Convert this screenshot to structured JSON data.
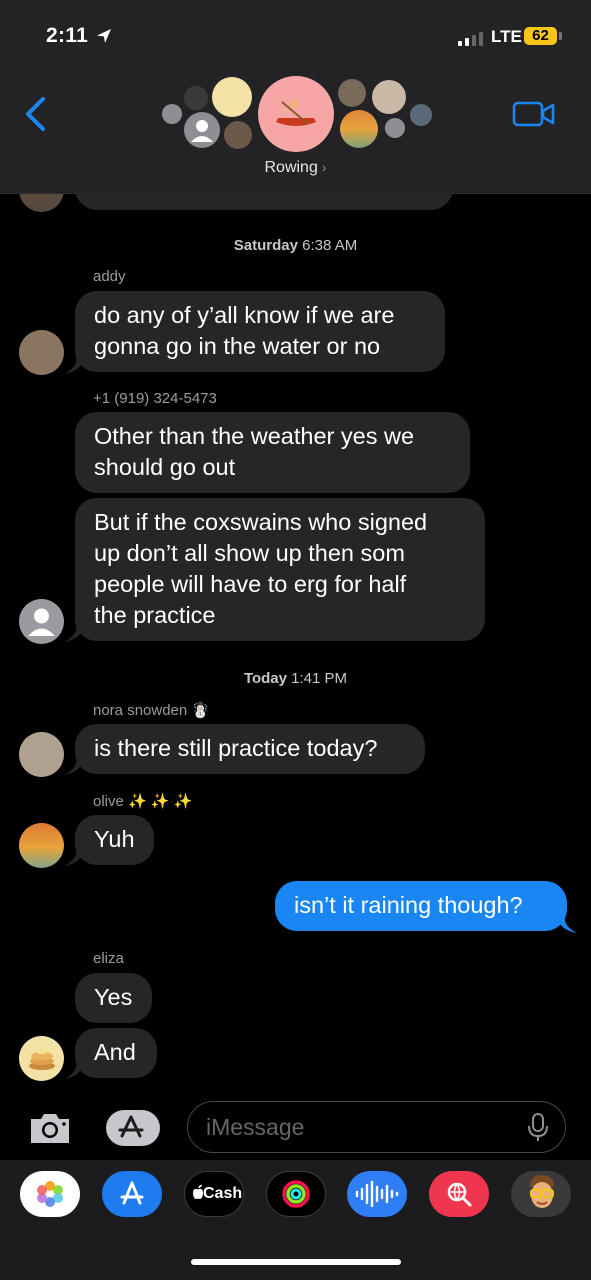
{
  "status_bar": {
    "time": "2:11",
    "network": "LTE",
    "battery": "62"
  },
  "header": {
    "group_name": "Rowing",
    "chevron": "›"
  },
  "messages": {
    "ts1": {
      "day": "Saturday",
      "time": "6:38 AM"
    },
    "addy": {
      "sender": "addy",
      "line1": "do any of y’all know if we are",
      "line2": "gonna go in the water or no"
    },
    "phone": {
      "sender": "+1 (919) 324-5473",
      "m1_l1": "Other than the weather yes we",
      "m1_l2": "should go out",
      "m2_l1": "But if the coxswains who signed",
      "m2_l2": "up don’t all show up then som",
      "m2_l3": "people will have to erg for half",
      "m2_l4": "the practice"
    },
    "ts2": {
      "day": "Today",
      "time": "1:41 PM"
    },
    "nora": {
      "sender": "nora snowden",
      "emoji": "☃️",
      "text": "is there still practice today?"
    },
    "olive": {
      "sender": "olive",
      "emoji": "✨ ✨ ✨",
      "text": "Yuh"
    },
    "me": {
      "text": "isn’t it raining though?"
    },
    "eliza": {
      "sender": "eliza",
      "m1": "Yes",
      "m2": "And"
    }
  },
  "composer": {
    "placeholder": "iMessage"
  },
  "apps": {
    "cash_label": "Cash"
  },
  "colors": {
    "accent": "#1a86f3",
    "bubble_in": "#262628",
    "header_bg": "#232325",
    "battery": "#f5c518"
  }
}
